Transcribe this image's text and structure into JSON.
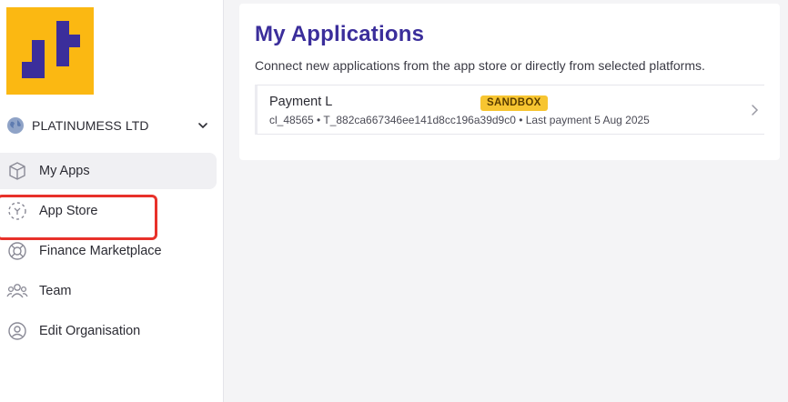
{
  "sidebar": {
    "org_name": "PLATINUMESS LTD",
    "items": [
      {
        "label": "My Apps",
        "icon": "box-icon",
        "active": true
      },
      {
        "label": "App Store",
        "icon": "app-store-icon",
        "active": false
      },
      {
        "label": "Finance Marketplace",
        "icon": "lifebuoy-icon",
        "active": false
      },
      {
        "label": "Team",
        "icon": "team-icon",
        "active": false
      },
      {
        "label": "Edit Organisation",
        "icon": "user-circle-icon",
        "active": false
      }
    ]
  },
  "main": {
    "title": "My Applications",
    "description": "Connect new applications from the app store or directly from selected platforms.",
    "apps": [
      {
        "name": "Payment L",
        "badge": "SANDBOX",
        "meta": "cl_48565 • T_882ca667346ee141d8cc196a39d9c0 • Last payment 5 Aug 2025"
      }
    ]
  },
  "colors": {
    "brand_yellow": "#fbb812",
    "brand_purple": "#3b2e9b",
    "badge_yellow": "#f7c531",
    "highlight_red": "#e8312a"
  }
}
